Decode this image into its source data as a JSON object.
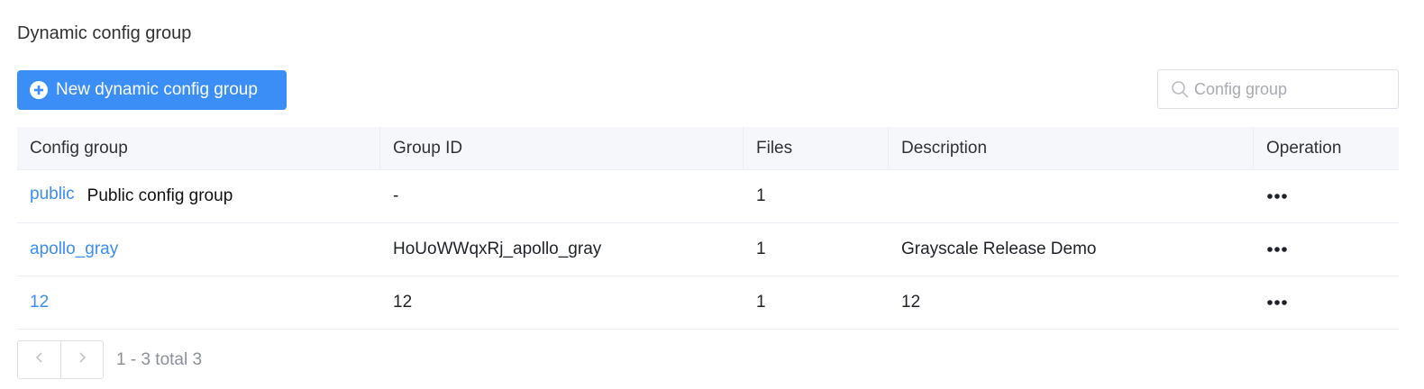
{
  "page": {
    "title": "Dynamic config group"
  },
  "toolbar": {
    "new_button_label": "New dynamic config group",
    "search_placeholder": "Config group",
    "search_value": ""
  },
  "table": {
    "columns": [
      "Config group",
      "Group ID",
      "Files",
      "Description",
      "Operation"
    ],
    "rows": [
      {
        "name": "public",
        "name_tag": "Public config group",
        "group_id": "-",
        "files": "1",
        "description": ""
      },
      {
        "name": "apollo_gray",
        "name_tag": "",
        "group_id": "HoUoWWqxRj_apollo_gray",
        "files": "1",
        "description": "Grayscale Release Demo"
      },
      {
        "name": "12",
        "name_tag": "",
        "group_id": "12",
        "files": "1",
        "description": "12"
      }
    ]
  },
  "pagination": {
    "info": "1 - 3 total 3"
  },
  "colors": {
    "accent": "#3a8ef6",
    "header_bg": "#f5f7fa",
    "border": "#dcdfe6"
  },
  "icons": {
    "new_button": "plus-circle-icon",
    "search": "search-icon",
    "operation": "more-horizontal-icon",
    "prev": "chevron-left-icon",
    "next": "chevron-right-icon"
  }
}
